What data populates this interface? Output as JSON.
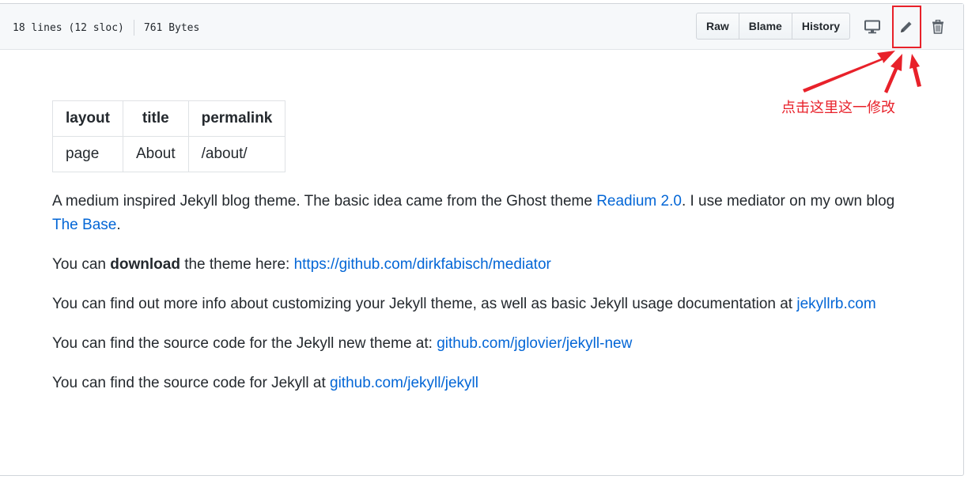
{
  "file_header": {
    "lines_info": "18 lines (12 sloc)",
    "size_info": "761 Bytes",
    "buttons": [
      "Raw",
      "Blame",
      "History"
    ],
    "icons": [
      "desktop-icon",
      "pencil-icon",
      "trash-icon"
    ]
  },
  "annotation": {
    "text": "点击这里这一修改",
    "color": "#e8212a"
  },
  "table": {
    "headers": [
      "layout",
      "title",
      "permalink"
    ],
    "row": [
      "page",
      "About",
      "/about/"
    ]
  },
  "paragraphs": {
    "p1_pre": "A medium inspired Jekyll blog theme. The basic idea came from the Ghost theme ",
    "p1_link1": "Readium 2.0",
    "p1_mid": ". I use mediator on my own blog ",
    "p1_link2": "The Base",
    "p1_post": ".",
    "p2_pre": "You can ",
    "p2_bold": "download",
    "p2_mid": " the theme here: ",
    "p2_link": "https://github.com/dirkfabisch/mediator",
    "p3_pre": "You can find out more info about customizing your Jekyll theme, as well as basic Jekyll usage documentation at ",
    "p3_link": "jekyllrb.com",
    "p4_pre": "You can find the source code for the Jekyll new theme at: ",
    "p4_link": "github.com/jglovier/jekyll-new",
    "p5_pre": "You can find the source code for Jekyll at ",
    "p5_link": "github.com/jekyll/jekyll"
  },
  "colors": {
    "link": "#0366d6",
    "annotation": "#e8212a"
  }
}
